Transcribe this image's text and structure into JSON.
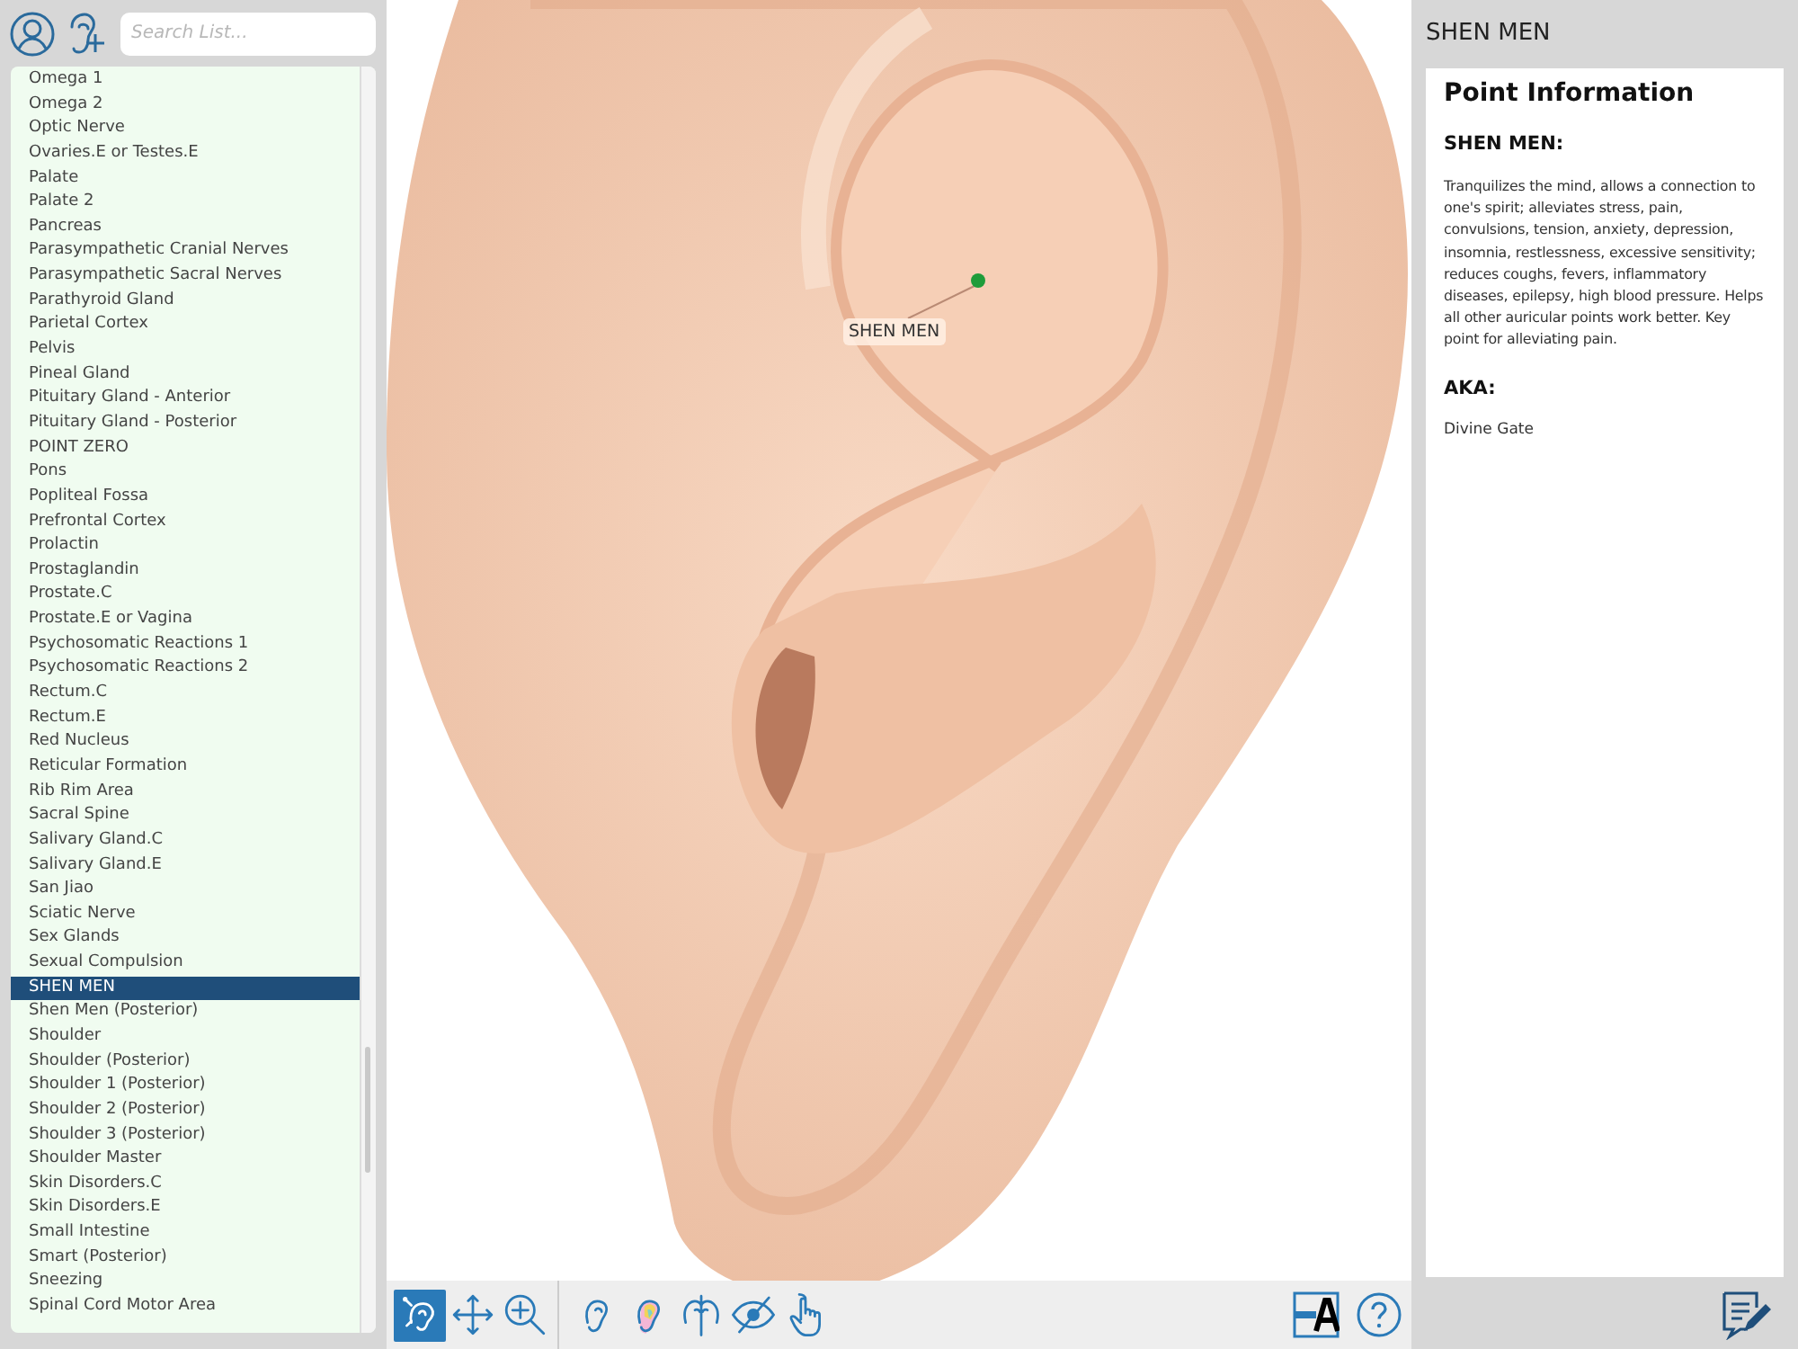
{
  "search": {
    "placeholder": "Search List..."
  },
  "points": [
    {
      "label": "Omega 1",
      "selected": false
    },
    {
      "label": "Omega 2",
      "selected": false
    },
    {
      "label": "Optic Nerve",
      "selected": false
    },
    {
      "label": "Ovaries.E or Testes.E",
      "selected": false
    },
    {
      "label": "Palate",
      "selected": false
    },
    {
      "label": "Palate 2",
      "selected": false
    },
    {
      "label": "Pancreas",
      "selected": false
    },
    {
      "label": "Parasympathetic Cranial Nerves",
      "selected": false
    },
    {
      "label": "Parasympathetic Sacral Nerves",
      "selected": false
    },
    {
      "label": "Parathyroid Gland",
      "selected": false
    },
    {
      "label": "Parietal Cortex",
      "selected": false
    },
    {
      "label": "Pelvis",
      "selected": false
    },
    {
      "label": "Pineal Gland",
      "selected": false
    },
    {
      "label": "Pituitary Gland - Anterior",
      "selected": false
    },
    {
      "label": "Pituitary Gland - Posterior",
      "selected": false
    },
    {
      "label": "POINT ZERO",
      "selected": false
    },
    {
      "label": "Pons",
      "selected": false
    },
    {
      "label": "Popliteal Fossa",
      "selected": false
    },
    {
      "label": "Prefrontal Cortex",
      "selected": false
    },
    {
      "label": "Prolactin",
      "selected": false
    },
    {
      "label": "Prostaglandin",
      "selected": false
    },
    {
      "label": "Prostate.C",
      "selected": false
    },
    {
      "label": "Prostate.E or Vagina",
      "selected": false
    },
    {
      "label": "Psychosomatic Reactions 1",
      "selected": false
    },
    {
      "label": "Psychosomatic Reactions 2",
      "selected": false
    },
    {
      "label": "Rectum.C",
      "selected": false
    },
    {
      "label": "Rectum.E",
      "selected": false
    },
    {
      "label": "Red Nucleus",
      "selected": false
    },
    {
      "label": "Reticular Formation",
      "selected": false
    },
    {
      "label": "Rib Rim Area",
      "selected": false
    },
    {
      "label": "Sacral Spine",
      "selected": false
    },
    {
      "label": "Salivary Gland.C",
      "selected": false
    },
    {
      "label": "Salivary Gland.E",
      "selected": false
    },
    {
      "label": "San Jiao",
      "selected": false
    },
    {
      "label": "Sciatic Nerve",
      "selected": false
    },
    {
      "label": "Sex Glands",
      "selected": false
    },
    {
      "label": "Sexual Compulsion",
      "selected": false
    },
    {
      "label": "SHEN MEN",
      "selected": true
    },
    {
      "label": "Shen Men (Posterior)",
      "selected": false
    },
    {
      "label": "Shoulder",
      "selected": false
    },
    {
      "label": "Shoulder (Posterior)",
      "selected": false
    },
    {
      "label": "Shoulder 1 (Posterior)",
      "selected": false
    },
    {
      "label": "Shoulder 2 (Posterior)",
      "selected": false
    },
    {
      "label": "Shoulder 3 (Posterior)",
      "selected": false
    },
    {
      "label": "Shoulder Master",
      "selected": false
    },
    {
      "label": "Skin Disorders.C",
      "selected": false
    },
    {
      "label": "Skin Disorders.E",
      "selected": false
    },
    {
      "label": "Small Intestine",
      "selected": false
    },
    {
      "label": "Smart (Posterior)",
      "selected": false
    },
    {
      "label": "Sneezing",
      "selected": false
    },
    {
      "label": "Spinal Cord Motor Area",
      "selected": false
    }
  ],
  "ear_view": {
    "marker_label": "SHEN MEN"
  },
  "toolbar": {
    "tools": [
      {
        "selected": true
      },
      {
        "selected": false
      },
      {
        "selected": false
      },
      {
        "selected": false
      },
      {
        "selected": false
      },
      {
        "selected": false
      },
      {
        "selected": false
      },
      {
        "selected": false
      }
    ]
  },
  "info_panel": {
    "title": "SHEN MEN",
    "heading": "Point Information",
    "point_name": "SHEN MEN:",
    "description": "Tranquilizes the mind, allows a connection to one's spirit; alleviates stress, pain, convulsions, tension, anxiety, depression, insomnia, restlessness, excessive sensitivity; reduces coughs, fevers, inflammatory diseases, epilepsy, high blood pressure. Helps all other auricular points work better. Key point for alleviating pain.",
    "aka_heading": "AKA:",
    "aka": "Divine Gate"
  }
}
